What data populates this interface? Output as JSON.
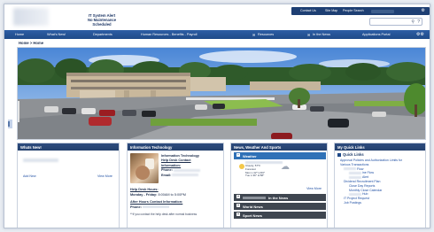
{
  "header": {
    "alert_title": "IT System Alert",
    "alert_sub": "No Maintenance Scheduled",
    "util": {
      "contact": "Contact Us",
      "sitemap": "Site Map",
      "people": "People Search"
    },
    "search": {
      "placeholder": ""
    }
  },
  "nav": {
    "items": [
      "Home",
      "What's New!",
      "Departments",
      "Human Resources - Benefits - Payroll",
      "Resources",
      "In the News",
      "Applications Portal"
    ]
  },
  "breadcrumb": "Home > Home",
  "panels": {
    "whats_new": {
      "title": "Whats New!",
      "add": "Add New",
      "more": "View More"
    },
    "it": {
      "title": "Information Technology",
      "info_title": "Information Technology",
      "help_contact": "Help Desk Contact",
      "info_label": "Information:",
      "phone_label": "Phone:",
      "email_label": "Email:",
      "hours_head": "Help Desk Hours:",
      "hours_days": "Monday - Friday:",
      "hours_time": "8:00AM to 5:00PM",
      "after_head": "After Hours Contact Information:",
      "after_phone": "Phone:",
      "note": "**If you contact the help desk after normal business"
    },
    "news": {
      "title": "News, Weather And Sports",
      "weather": "Weather",
      "wx_lines": [
        "Cloudy, 57°F",
        "Forecast",
        "Mon  L:42° H:60°",
        "Tue  L:39° H:58°"
      ],
      "more": "View More",
      "in_the_news": "In the News",
      "world_news": "World News",
      "sport_news": "Sport News"
    },
    "quick_links": {
      "title": "My Quick Links",
      "head": "Quick Links",
      "links": [
        "Approval Policies and Authorization Limits for",
        "Various Transactions",
        "Flow",
        "ine Flow",
        "Alert",
        "Dividend Recruitment Plan",
        "Close Day Reports",
        "Monthly Close Calendar",
        "Hub",
        "IT Project Request",
        "Job Postings"
      ]
    }
  },
  "colors": {
    "nav": "#1f4a88",
    "panel_head": "#23406d",
    "weather": "#2f71b7",
    "sub_head": "#3f4650"
  },
  "icons": [
    "search-icon",
    "help-icon",
    "gear-icon",
    "cloud-icon"
  ]
}
